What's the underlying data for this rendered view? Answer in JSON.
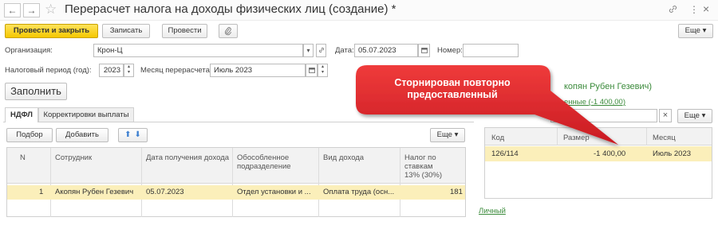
{
  "window": {
    "title": "Перерасчет налога на доходы физических лиц (создание) *",
    "back_icon": "←",
    "forward_icon": "→",
    "star_icon": "☆",
    "link_icon": "🔗",
    "more_icon": "⋮",
    "close_icon": "×"
  },
  "toolbar": {
    "post_close": "Провести и закрыть",
    "save": "Записать",
    "post": "Провести",
    "attach_icon": "📎",
    "more": "Еще ▾"
  },
  "form": {
    "org_label": "Организация:",
    "org_value": "Крон-Ц",
    "date_label": "Дата:",
    "date_value": "05.07.2023",
    "number_label": "Номер:",
    "number_value": "",
    "period_label": "Налоговый период (год):",
    "period_value": "2023",
    "month_label": "Месяц перерасчета:",
    "month_value": "Июль 2023",
    "fill_button": "Заполнить"
  },
  "tabs": {
    "ndfl": "НДФЛ",
    "corrections": "Корректировки выплаты"
  },
  "table_toolbar": {
    "select": "Подбор",
    "add": "Добавить",
    "up_icon": "🡅",
    "down_icon": "🡇",
    "more": "Еще ▾"
  },
  "table": {
    "headers": {
      "n": "N",
      "employee": "Сотрудник",
      "income_date": "Дата получения дохода",
      "subdivision": "Обособленное подразделение",
      "income_type": "Вид дохода",
      "tax": "Налог по ставкам",
      "tax_rate": "13% (30%)"
    },
    "rows": [
      {
        "n": "1",
        "employee": "Акопян Рубен Гезевич",
        "income_date": "05.07.2023",
        "subdivision": "Отдел установки и ...",
        "income_type": "Оплата труда (осн...",
        "tax": "181"
      }
    ]
  },
  "right_panel": {
    "person_partial": "копян Рубен Гезевич)",
    "link_partial": "енные (-1 400,00)",
    "more": "Еще ▾",
    "headers": {
      "code": "Код",
      "amount": "Размер",
      "month": "Месяц"
    },
    "rows": [
      {
        "code": "126/114",
        "amount": "-1 400,00",
        "month": "Июль 2023"
      }
    ],
    "personal_link": "Личный"
  },
  "callout": {
    "text": "Сторнирован повторно предоставленный"
  },
  "colors": {
    "accent_yellow": "#f5c800",
    "selected_row": "#fbefba",
    "callout_red": "#e0262e",
    "link_green": "#3a8a3a"
  }
}
